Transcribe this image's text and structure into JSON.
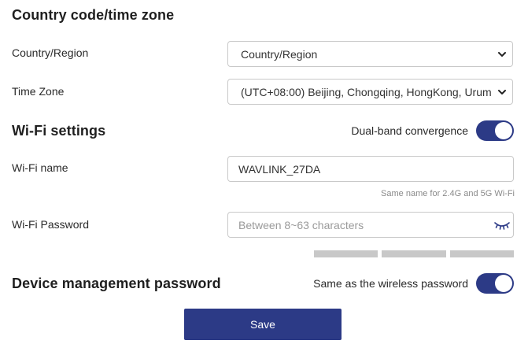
{
  "country_section": {
    "title": "Country code/time zone",
    "country_label": "Country/Region",
    "country_value": "Country/Region",
    "timezone_label": "Time Zone",
    "timezone_value": "(UTC+08:00) Beijing, Chongqing, HongKong, Urumqi"
  },
  "wifi_section": {
    "title": "Wi-Fi settings",
    "dual_band_label": "Dual-band convergence",
    "dual_band_on": true,
    "name_label": "Wi-Fi name",
    "name_value": "WAVLINK_27DA",
    "name_hint": "Same name for 2.4G and 5G Wi-Fi",
    "password_label": "Wi-Fi Password",
    "password_placeholder": "Between 8~63 characters",
    "password_strength_segments": 3,
    "password_strength_filled": 0
  },
  "device_section": {
    "title": "Device management password",
    "same_as_wireless_label": "Same as the wireless password",
    "same_as_wireless_on": true
  },
  "actions": {
    "save_label": "Save"
  },
  "icons": {
    "dropdown": "chevron-down-icon",
    "password_visibility": "eye-closed-icon"
  },
  "colors": {
    "accent": "#2c3a86",
    "strength_empty": "#c8c8c8"
  }
}
